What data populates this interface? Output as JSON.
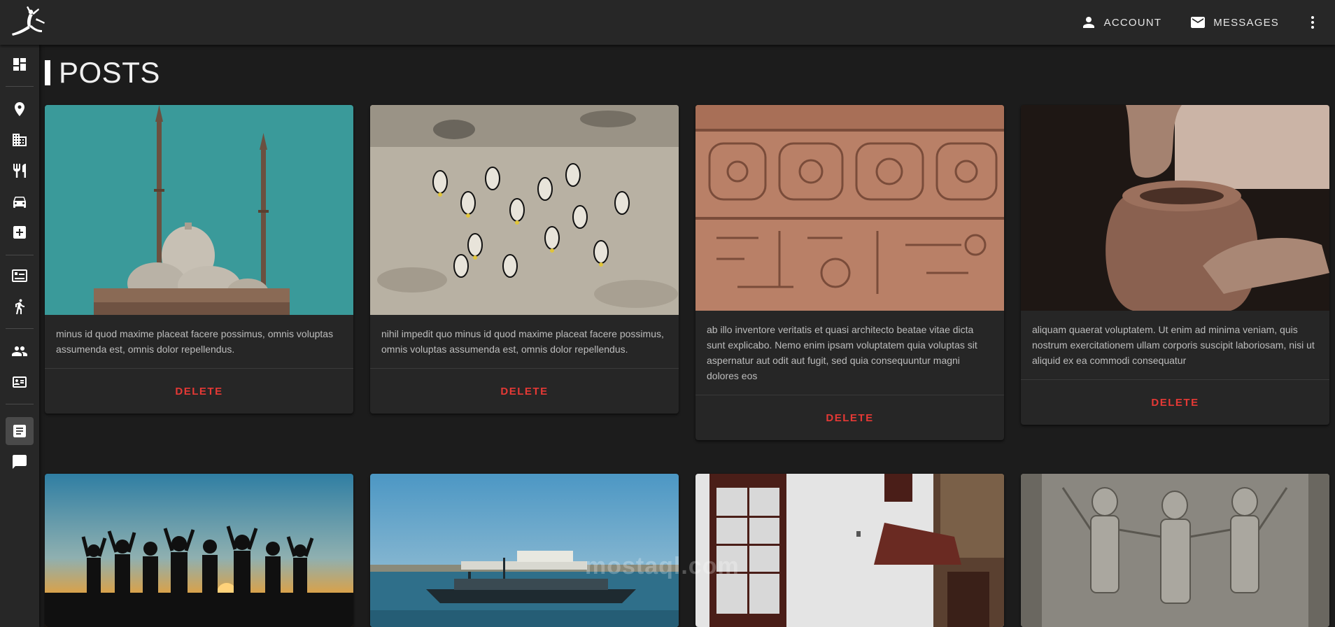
{
  "header": {
    "account_label": "ACCOUNT",
    "messages_label": "MESSAGES",
    "icons": {
      "account": "person-icon",
      "messages": "mail-icon",
      "more": "more-vert-icon",
      "logo": "dancer-logo-icon"
    }
  },
  "sidebar": {
    "items": [
      {
        "id": "dashboard",
        "icon": "dashboard-icon"
      },
      {
        "id": "places",
        "icon": "location-pin-icon"
      },
      {
        "id": "hotels",
        "icon": "building-icon"
      },
      {
        "id": "restaurants",
        "icon": "cutlery-icon"
      },
      {
        "id": "transport",
        "icon": "car-icon"
      },
      {
        "id": "medical",
        "icon": "medical-cross-icon"
      },
      {
        "id": "articles",
        "icon": "article-icon"
      },
      {
        "id": "activities",
        "icon": "person-hiking-icon"
      },
      {
        "id": "users",
        "icon": "group-icon"
      },
      {
        "id": "guides",
        "icon": "id-card-icon"
      },
      {
        "id": "posts",
        "icon": "post-icon",
        "active": true
      },
      {
        "id": "chat",
        "icon": "chat-icon"
      }
    ]
  },
  "page": {
    "title": "POSTS"
  },
  "posts": [
    {
      "text": "minus id quod maxime placeat facere possimus, omnis voluptas assumenda est, omnis dolor repellendus.",
      "action": "DELETE",
      "image": "mosque"
    },
    {
      "text": "nihil impedit quo minus id quod maxime placeat facere possimus, omnis voluptas assumenda est, omnis dolor repellendus.",
      "action": "DELETE",
      "image": "fish"
    },
    {
      "text": "ab illo inventore veritatis et quasi architecto beatae vitae dicta sunt explicabo. Nemo enim ipsam voluptatem quia voluptas sit aspernatur aut odit aut fugit, sed quia consequuntur magni dolores eos",
      "action": "DELETE",
      "image": "hieroglyphs"
    },
    {
      "text": "aliquam quaerat voluptatem. Ut enim ad minima veniam, quis nostrum exercitationem ullam corporis suscipit laboriosam, nisi ut aliquid ex ea commodi consequatur",
      "action": "DELETE",
      "image": "pottery"
    },
    {
      "text": "",
      "action": "",
      "image": "sunset-people"
    },
    {
      "text": "",
      "action": "",
      "image": "harbor-boats"
    },
    {
      "text": "",
      "action": "",
      "image": "white-building"
    },
    {
      "text": "",
      "action": "",
      "image": "temple-relief"
    }
  ],
  "watermark": "mostaql.com",
  "colors": {
    "topbar": "#272727",
    "background": "#1c1c1c",
    "card": "#262626",
    "delete": "#e53935",
    "active_nav": "#4a4a4a"
  }
}
